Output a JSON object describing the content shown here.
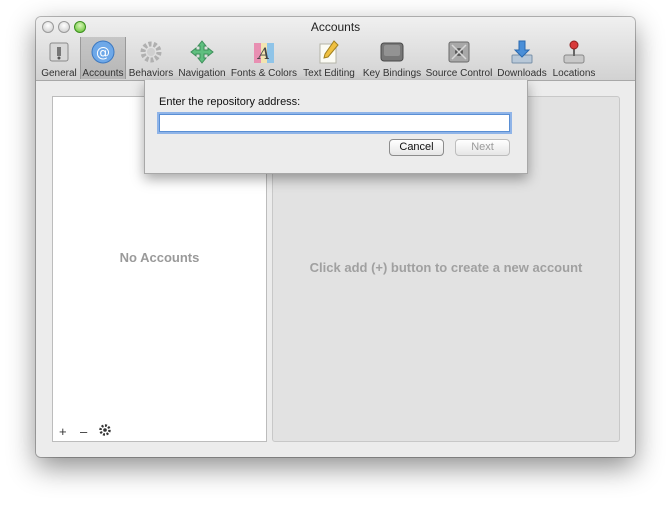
{
  "window": {
    "title": "Accounts"
  },
  "toolbar": {
    "items": [
      {
        "label": "General",
        "icon": "general-switch-icon"
      },
      {
        "label": "Accounts",
        "icon": "at-sign-icon",
        "selected": true
      },
      {
        "label": "Behaviors",
        "icon": "gears-icon"
      },
      {
        "label": "Navigation",
        "icon": "navigation-arrows-icon"
      },
      {
        "label": "Fonts & Colors",
        "icon": "fonts-colors-icon"
      },
      {
        "label": "Text Editing",
        "icon": "pencil-paper-icon"
      },
      {
        "label": "Key Bindings",
        "icon": "keyboard-key-icon"
      },
      {
        "label": "Source Control",
        "icon": "source-control-icon"
      },
      {
        "label": "Downloads",
        "icon": "download-icon"
      },
      {
        "label": "Locations",
        "icon": "joystick-icon"
      }
    ]
  },
  "accounts_list": {
    "empty_text": "No Accounts",
    "add_label": "+",
    "remove_label": "–",
    "action_icon": "gear-icon"
  },
  "detail": {
    "hint": "Click add (+) button to create a new account"
  },
  "sheet": {
    "prompt": "Enter the repository address:",
    "input_value": "",
    "cancel_label": "Cancel",
    "next_label": "Next",
    "next_enabled": false
  },
  "colors": {
    "focus_ring": "#8fb4e8",
    "selected_tab": "#bcbcbc",
    "accounts_icon": "#6ea8e8"
  }
}
